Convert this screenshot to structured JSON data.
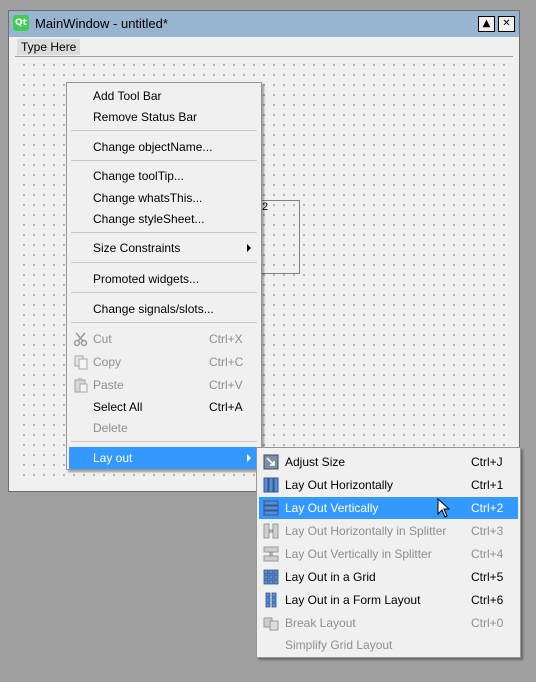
{
  "window": {
    "title": "MainWindow - untitled*",
    "logo_text": "Qt",
    "menubar_placeholder": "Type Here",
    "layout_label": "2"
  },
  "context_menu": {
    "items": [
      {
        "label": "Add Tool Bar"
      },
      {
        "label": "Remove Status Bar"
      },
      {
        "label": "Change objectName..."
      },
      {
        "label": "Change toolTip..."
      },
      {
        "label": "Change whatsThis..."
      },
      {
        "label": "Change styleSheet..."
      },
      {
        "label": "Size Constraints"
      },
      {
        "label": "Promoted widgets..."
      },
      {
        "label": "Change signals/slots..."
      },
      {
        "label": "Cut",
        "shortcut": "Ctrl+X",
        "icon": "scissors-icon"
      },
      {
        "label": "Copy",
        "shortcut": "Ctrl+C",
        "icon": "copy-icon"
      },
      {
        "label": "Paste",
        "shortcut": "Ctrl+V",
        "icon": "paste-icon"
      },
      {
        "label": "Select All",
        "shortcut": "Ctrl+A"
      },
      {
        "label": "Delete"
      },
      {
        "label": "Lay out"
      }
    ]
  },
  "layout_submenu": {
    "items": [
      {
        "label": "Adjust Size",
        "shortcut": "Ctrl+J",
        "icon": "adjust-size-icon"
      },
      {
        "label": "Lay Out Horizontally",
        "shortcut": "Ctrl+1",
        "icon": "layout-horizontal-icon"
      },
      {
        "label": "Lay Out Vertically",
        "shortcut": "Ctrl+2",
        "icon": "layout-vertical-icon"
      },
      {
        "label": "Lay Out Horizontally in Splitter",
        "shortcut": "Ctrl+3",
        "icon": "splitter-horizontal-icon"
      },
      {
        "label": "Lay Out Vertically in Splitter",
        "shortcut": "Ctrl+4",
        "icon": "splitter-vertical-icon"
      },
      {
        "label": "Lay Out in a Grid",
        "shortcut": "Ctrl+5",
        "icon": "grid-layout-icon"
      },
      {
        "label": "Lay Out in a Form Layout",
        "shortcut": "Ctrl+6",
        "icon": "form-layout-icon"
      },
      {
        "label": "Break Layout",
        "shortcut": "Ctrl+0",
        "icon": "break-layout-icon"
      },
      {
        "label": "Simplify Grid Layout"
      }
    ]
  },
  "colors": {
    "highlight": "#3399ff",
    "titlebar": "#99b4d1",
    "disabled_text": "#8e8e8e"
  }
}
